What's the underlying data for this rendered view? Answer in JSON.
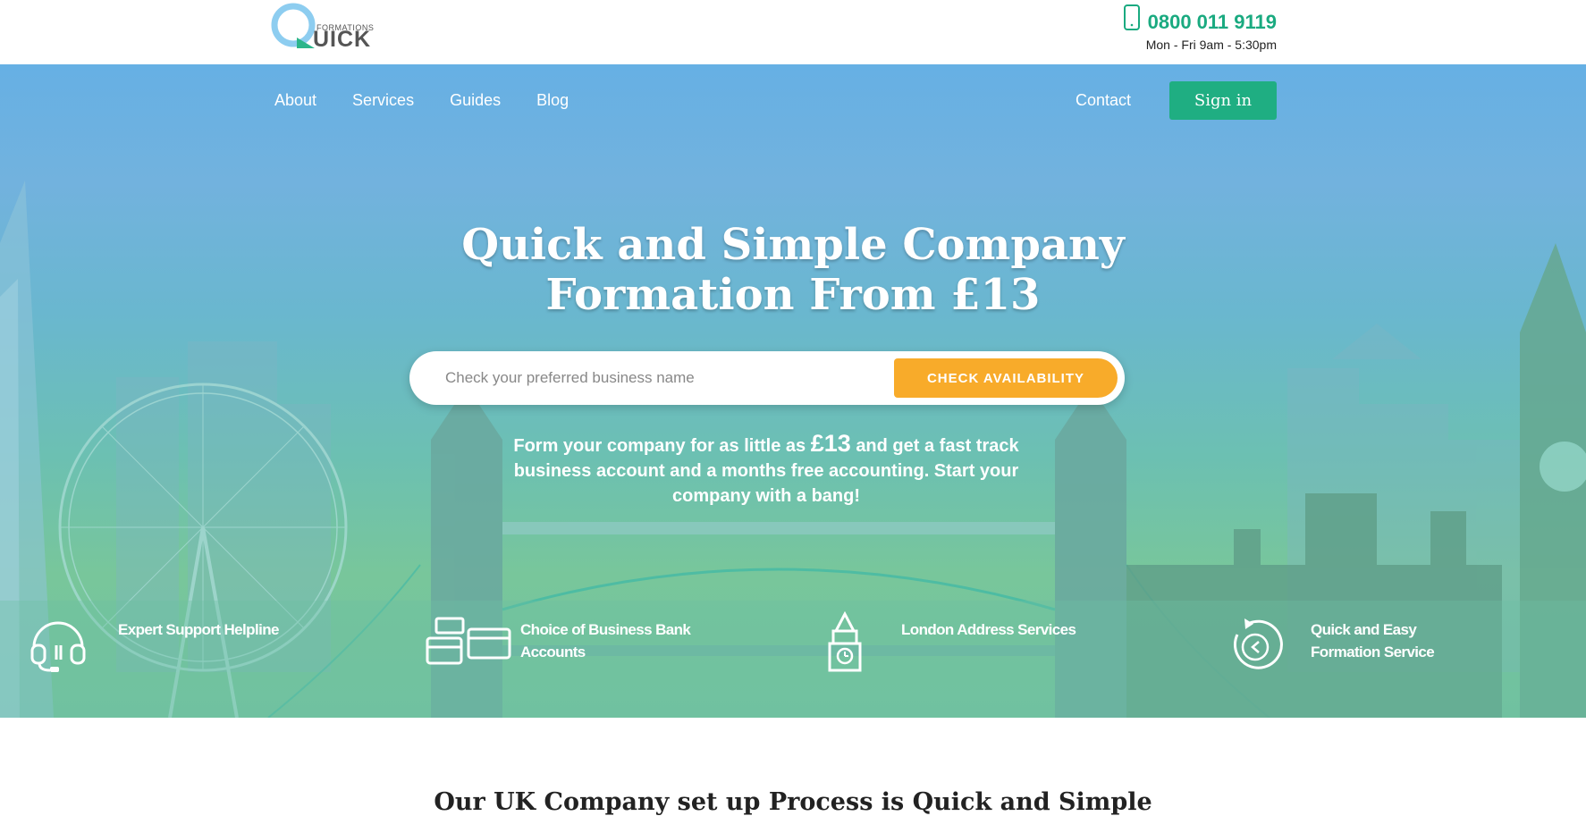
{
  "brand": {
    "logo_small": "FORMATIONS",
    "logo_big": "UICK",
    "logo_letter": "Q"
  },
  "contact": {
    "phone": "0800 011 9119",
    "hours": "Mon - Fri 9am - 5:30pm"
  },
  "nav": {
    "items": [
      "About",
      "Services",
      "Guides",
      "Blog"
    ],
    "contact_label": "Contact",
    "signin_label": "Sign in"
  },
  "hero": {
    "title_line1": "Quick and Simple Company",
    "title_line2": "Formation From £13",
    "search_placeholder": "Check your preferred business name",
    "search_button": "CHECK AVAILABILITY",
    "sub_before": "Form your company for as little as",
    "sub_price": "£13",
    "sub_after": "and get a fast track business account and a months free accounting. Start your company with a bang!"
  },
  "features": [
    {
      "icon": "headset-icon",
      "label": "Expert Support Helpline"
    },
    {
      "icon": "bank-cards-icon",
      "label": "Choice of Business Bank Accounts"
    },
    {
      "icon": "clock-tower-icon",
      "label": "London Address Services"
    },
    {
      "icon": "refresh-arrow-icon",
      "label": "Quick and Easy Formation Service"
    }
  ],
  "section": {
    "title": "Our UK Company set up Process is Quick and Simple"
  },
  "colors": {
    "brand_green": "#1fae82",
    "accent_orange": "#f8ab2a",
    "phone_green": "#1aaa80",
    "logo_blue": "#7cc4ec"
  }
}
